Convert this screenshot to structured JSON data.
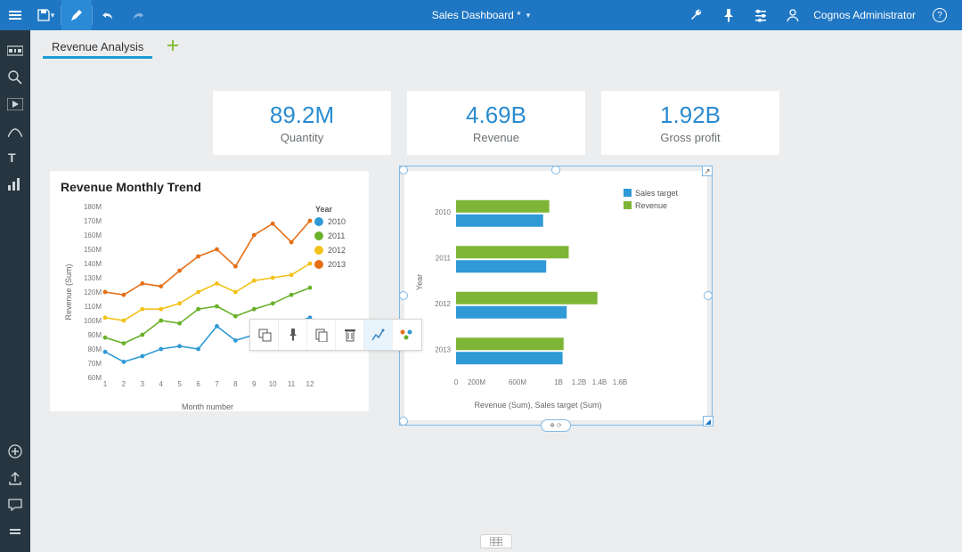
{
  "header": {
    "title": "Sales Dashboard *",
    "user": "Cognos Administrator"
  },
  "tabs": {
    "active": "Revenue Analysis"
  },
  "kpis": [
    {
      "value": "89.2M",
      "label": "Quantity"
    },
    {
      "value": "4.69B",
      "label": "Revenue"
    },
    {
      "value": "1.92B",
      "label": "Gross profit"
    }
  ],
  "chart_data": [
    {
      "type": "line",
      "title": "Revenue Monthly Trend",
      "xlabel": "Month number",
      "ylabel": "Revenue (Sum)",
      "legend_title": "Year",
      "ylim": [
        60,
        180
      ],
      "yticks": [
        "60M",
        "70M",
        "80M",
        "90M",
        "100M",
        "110M",
        "120M",
        "130M",
        "140M",
        "150M",
        "160M",
        "170M",
        "180M"
      ],
      "x": [
        1,
        2,
        3,
        4,
        5,
        6,
        7,
        8,
        9,
        10,
        11,
        12
      ],
      "series": [
        {
          "name": "2010",
          "color": "#2f9ad6",
          "values": [
            78,
            71,
            75,
            80,
            82,
            80,
            96,
            86,
            90,
            93,
            98,
            102
          ]
        },
        {
          "name": "2011",
          "color": "#6ab02a",
          "values": [
            88,
            84,
            90,
            100,
            98,
            108,
            110,
            103,
            108,
            112,
            118,
            123
          ]
        },
        {
          "name": "2012",
          "color": "#f2c21a",
          "values": [
            102,
            100,
            108,
            108,
            112,
            120,
            126,
            120,
            128,
            130,
            132,
            140
          ]
        },
        {
          "name": "2013",
          "color": "#e56f17",
          "values": [
            120,
            118,
            126,
            124,
            135,
            145,
            150,
            138,
            160,
            168,
            155,
            170
          ]
        }
      ]
    },
    {
      "type": "bar",
      "orientation": "horizontal",
      "xlabel": "Revenue (Sum), Sales target (Sum)",
      "ylabel": "Year",
      "xlim": [
        0,
        1600
      ],
      "xticks": [
        "0",
        "200M",
        "600M",
        "1B",
        "1.2B",
        "1.4B",
        "1.6B"
      ],
      "categories": [
        "2010",
        "2011",
        "2012",
        "2013"
      ],
      "series": [
        {
          "name": "Sales target",
          "color": "#2f9ad6",
          "values": [
            850,
            880,
            1080,
            1040
          ]
        },
        {
          "name": "Revenue",
          "color": "#7fb537",
          "values": [
            910,
            1100,
            1380,
            1050
          ]
        }
      ]
    }
  ],
  "colors": {
    "toolbar": "#1f77c3",
    "sidebar": "#26353f",
    "accent": "#2a8bd0"
  }
}
